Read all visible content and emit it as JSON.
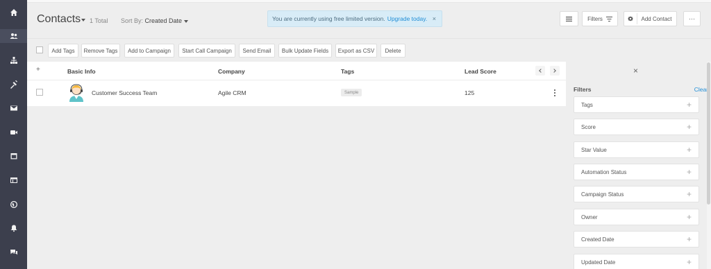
{
  "sidebar": {
    "items": [
      {
        "name": "home-icon"
      },
      {
        "name": "contacts-icon",
        "active": true
      },
      {
        "name": "companies-icon"
      },
      {
        "name": "deals-icon"
      },
      {
        "name": "email-icon"
      },
      {
        "name": "video-icon"
      },
      {
        "name": "calendar-icon"
      },
      {
        "name": "web-icon"
      },
      {
        "name": "globe-icon"
      },
      {
        "name": "notification-icon"
      },
      {
        "name": "chat-icon"
      }
    ]
  },
  "header": {
    "title": "Contacts",
    "total": "1 Total",
    "sort_prefix": "Sort By:",
    "sort_value": "Created Date",
    "notice_text": "You are currently using free limited version.",
    "notice_link": "Upgrade today.",
    "notice_close": "×",
    "filters_label": "Filters",
    "add_contact_label": "Add Contact",
    "more_label": "···"
  },
  "toolbar": {
    "buttons": [
      "Add Tags",
      "Remove Tags",
      "Add to Campaign",
      "Start Call Campaign",
      "Send Email",
      "Bulk Update Fields",
      "Export as CSV",
      "Delete"
    ]
  },
  "table": {
    "add_column": "+",
    "columns": [
      "Basic Info",
      "Company",
      "Tags",
      "Lead Score"
    ],
    "rows": [
      {
        "name": "Customer Success Team",
        "company": "Agile CRM",
        "tag": "Sample",
        "lead_score": "125"
      }
    ]
  },
  "filters": {
    "close": "×",
    "title": "Filters",
    "clear": "Clear",
    "plus": "+",
    "items": [
      "Tags",
      "Score",
      "Star Value",
      "Automation Status",
      "Campaign Status",
      "Owner",
      "Created Date",
      "Updated Date"
    ]
  },
  "colors": {
    "sidebar": "#3c3f4d",
    "accent": "#1f8dd6",
    "notice_bg": "#d8ecf7"
  }
}
